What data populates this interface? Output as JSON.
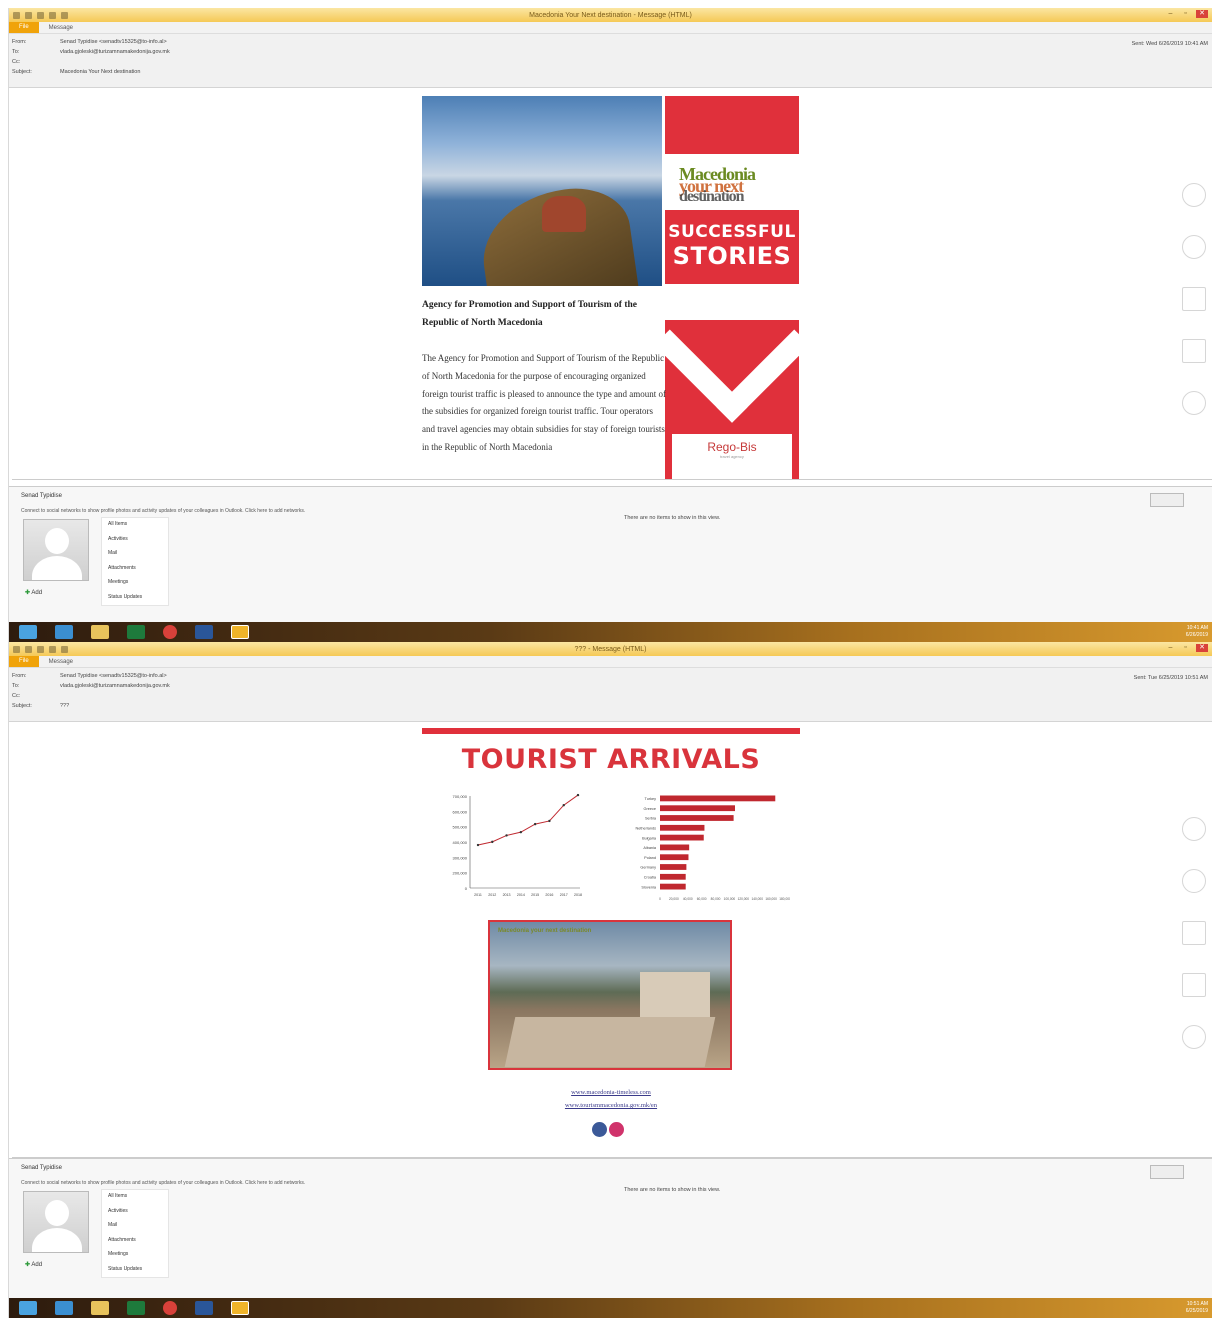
{
  "email1": {
    "window_title": "Macedonia Your Next destination - Message (HTML)",
    "tabs": {
      "file": "File",
      "message": "Message"
    },
    "header": {
      "from_label": "From:",
      "from_value": "Senad Typidise <senadtv15325@to-info.al>",
      "to_label": "To:",
      "to_value": "vlada.gjoleski@turizamnamakedonija.gov.mk",
      "cc_label": "Cc:",
      "cc_value": "",
      "subject_label": "Subject:",
      "subject_value": "Macedonia Your Next destination",
      "sent_label": "Sent:",
      "sent_value": "Wed 6/26/2019 10:41 AM"
    },
    "body": {
      "logo_line1": "Macedonia",
      "logo_line2": "your next",
      "logo_line3": "destination",
      "stories_1": "SUCCESSFUL",
      "stories_2": "STORIES",
      "agency_title": "Agency for Promotion and Support of Tourism of the Republic of North Macedonia",
      "paragraph": "The Agency for Promotion and Support of Tourism of the Republic of North Macedonia for the purpose of encouraging organized foreign tourist traffic is pleased to announce the type and amount of the subsidies for organized foreign tourist traffic. Tour operators and travel agencies may obtain subsidies for stay of foreign tourists in the Republic of North Macedonia",
      "rego_title": "Rego-Bis",
      "rego_sub": "travel agency"
    },
    "people": {
      "name": "Senad Typidise",
      "connect": "Connect to social networks to show profile photos and activity updates of your colleagues in Outlook. Click here to add networks.",
      "add": "Add",
      "items": [
        "All Items",
        "Activities",
        "Mail",
        "Attachments",
        "Meetings",
        "Status Updates"
      ],
      "nodata": "There are no items to show in this view."
    },
    "clock": {
      "time": "10:41 AM",
      "date": "6/26/2019"
    }
  },
  "email2": {
    "window_title": "??? - Message (HTML)",
    "tabs": {
      "file": "File",
      "message": "Message"
    },
    "header": {
      "from_label": "From:",
      "from_value": "Senad Typidise <senadtv15325@to-info.al>",
      "to_label": "To:",
      "to_value": "vlada.gjoleski@turizamnamakedonija.gov.mk",
      "cc_label": "Cc:",
      "cc_value": "",
      "subject_label": "Subject:",
      "subject_value": "???",
      "sent_label": "Sent:",
      "sent_value": "Tue 6/25/2019 10:51 AM"
    },
    "body": {
      "title": "TOURIST ARRIVALS",
      "photo_caption": "Macedonia your next destination",
      "link1": "www.macedonia-timeless.com",
      "link2": "www.tourismmacedonia.gov.mk/en"
    },
    "people": {
      "name": "Senad Typidise",
      "connect": "Connect to social networks to show profile photos and activity updates of your colleagues in Outlook. Click here to add networks.",
      "add": "Add",
      "items": [
        "All Items",
        "Activities",
        "Mail",
        "Attachments",
        "Meetings",
        "Status Updates"
      ],
      "nodata": "There are no items to show in this view."
    },
    "clock": {
      "time": "10:51 AM",
      "date": "6/25/2019"
    }
  },
  "chart_data": [
    {
      "type": "line",
      "x": [
        "2011",
        "2012",
        "2013",
        "2014",
        "2015",
        "2016",
        "2017",
        "2018"
      ],
      "values": [
        327000,
        351000,
        400000,
        425000,
        486000,
        510000,
        630000,
        707000
      ],
      "yticks": [
        "700,000",
        "600,000",
        "500,000",
        "400,000",
        "300,000",
        "200,000",
        "0"
      ],
      "ylim": [
        0,
        700000
      ],
      "color": "#c0282f"
    },
    {
      "type": "bar",
      "orientation": "horizontal",
      "categories": [
        "Turkey",
        "Greece",
        "Serbia",
        "Netherlands",
        "Bulgaria",
        "Albania",
        "Poland",
        "Germany",
        "Croatia",
        "Slovenia"
      ],
      "values": [
        166000,
        108000,
        106000,
        64000,
        63000,
        42000,
        41000,
        38000,
        37000,
        37000
      ],
      "xticks": [
        "0",
        "20,000",
        "40,000",
        "60,000",
        "80,000",
        "100,000",
        "120,000",
        "140,000",
        "160,000",
        "180,000"
      ],
      "xlim": [
        0,
        180000
      ],
      "color": "#c0282f"
    }
  ]
}
